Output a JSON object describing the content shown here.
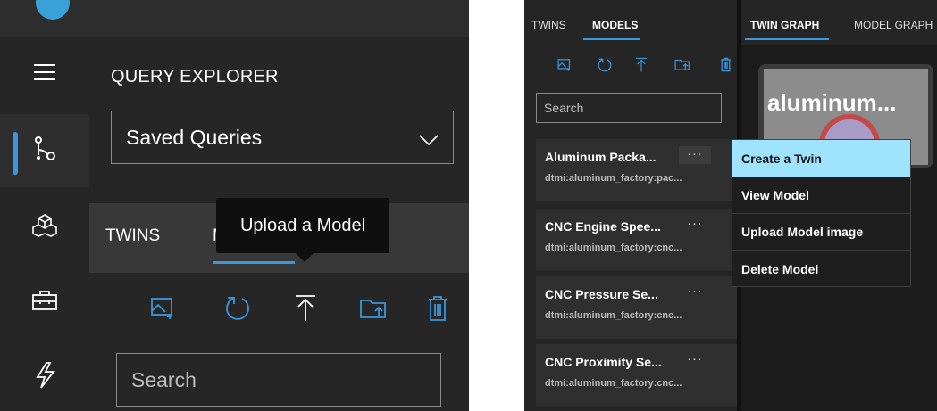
{
  "left": {
    "title": "QUERY EXPLORER",
    "saved_queries": "Saved Queries",
    "tab_twins": "TWINS",
    "tab_models_fragment": "M",
    "tooltip": "Upload a Model",
    "search_placeholder": "Search",
    "rail_icons": [
      "menu-icon",
      "graph-icon",
      "cubes-icon",
      "toolbox-icon",
      "lightning-icon"
    ],
    "toolbar_icons": [
      "image-add-icon",
      "refresh-icon",
      "upload-icon",
      "folder-upload-icon",
      "delete-icon"
    ]
  },
  "right": {
    "tabs": {
      "twins": "TWINS",
      "models": "MODELS",
      "twin_graph": "TWIN GRAPH",
      "model_graph": "MODEL GRAPH"
    },
    "search_placeholder": "Search",
    "cards": [
      {
        "name": "Aluminum Packa...",
        "id": "dtmi:aluminum_factory:pac...",
        "more": "···"
      },
      {
        "name": "CNC Engine Spee...",
        "id": "dtmi:aluminum_factory:cnc...",
        "more": "···"
      },
      {
        "name": "CNC Pressure Se...",
        "id": "dtmi:aluminum_factory:cnc...",
        "more": "···"
      },
      {
        "name": "CNC Proximity Se...",
        "id": "dtmi:aluminum_factory:cnc...",
        "more": "···"
      }
    ],
    "thumbnail_text": "aluminum...",
    "context_menu": [
      "Create a Twin",
      "View Model",
      "Upload Model image",
      "Delete Model"
    ],
    "colors": {
      "accent": "#3a96dd",
      "menu_highlight": "#9ee4ff"
    }
  }
}
